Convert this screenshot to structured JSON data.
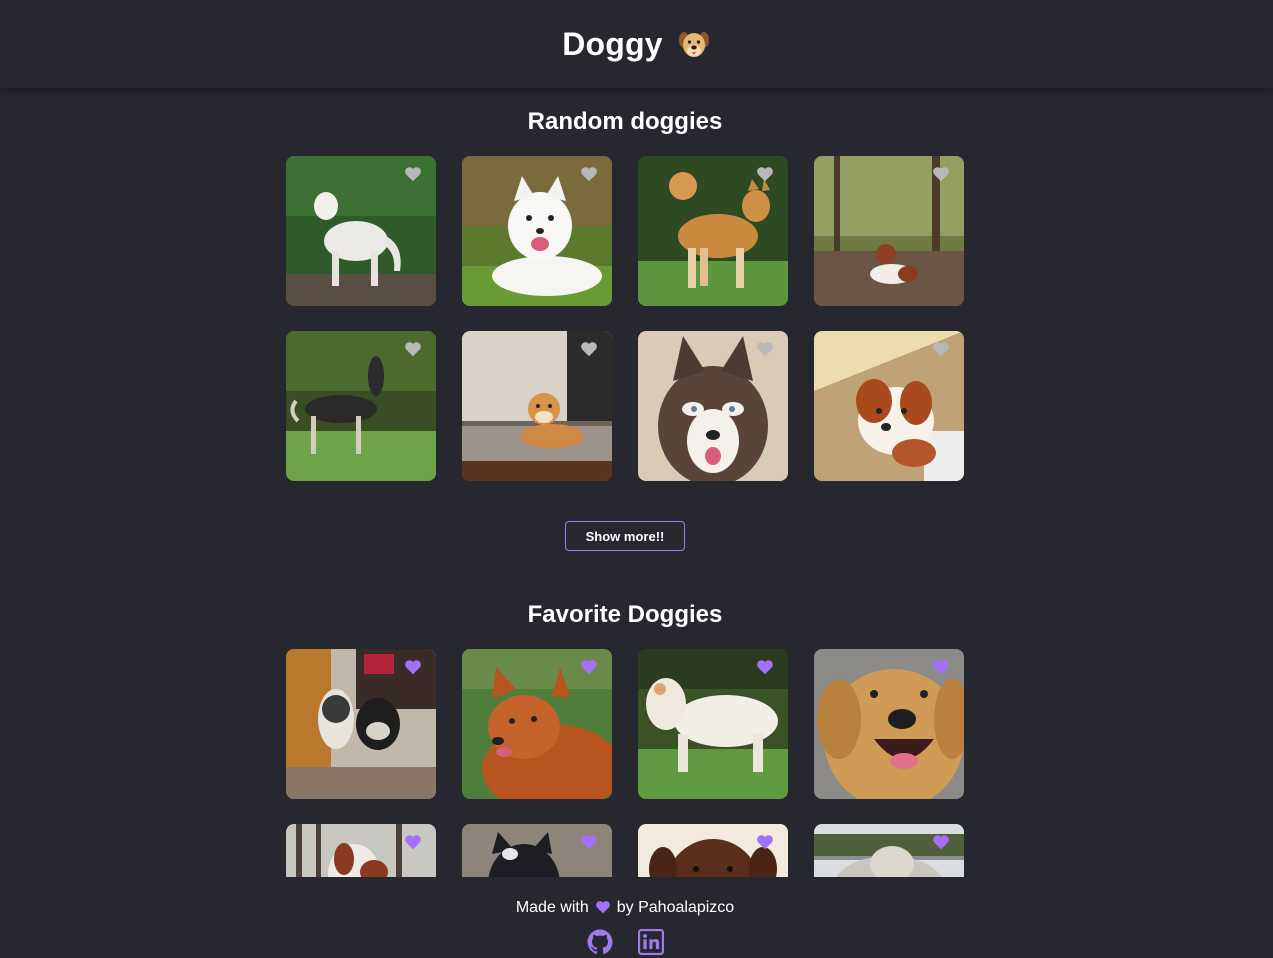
{
  "header": {
    "title": "Doggy",
    "logo_icon": "dog-face-icon"
  },
  "random": {
    "title": "Random doggies",
    "dogs": [
      {
        "desc": "white shepherd on grass",
        "favorited": false
      },
      {
        "desc": "white samoyed lying on grass",
        "favorited": false
      },
      {
        "desc": "shiba inu standing",
        "favorited": false
      },
      {
        "desc": "spaniel in forest",
        "favorited": false
      },
      {
        "desc": "saluki standing on lawn",
        "favorited": false
      },
      {
        "desc": "shiba inu lying on rug",
        "favorited": false
      },
      {
        "desc": "husky portrait",
        "favorited": false
      },
      {
        "desc": "cavalier puppy",
        "favorited": false
      }
    ]
  },
  "show_more_label": "Show more!!",
  "favorites": {
    "title": "Favorite Doggies",
    "dogs": [
      {
        "favorited": true
      },
      {
        "favorited": true
      },
      {
        "favorited": true
      },
      {
        "favorited": true
      },
      {
        "favorited": true
      },
      {
        "favorited": true
      },
      {
        "favorited": true
      },
      {
        "favorited": true
      }
    ]
  },
  "footer": {
    "made_with": "Made with",
    "by": "by Pahoalapizco",
    "links": [
      {
        "icon": "github-icon"
      },
      {
        "icon": "linkedin-icon"
      }
    ]
  },
  "colors": {
    "background": "#27272f",
    "accent": "#9f7aea",
    "heart_inactive": "#b8b8b8",
    "heart_active": "#a371f7"
  }
}
